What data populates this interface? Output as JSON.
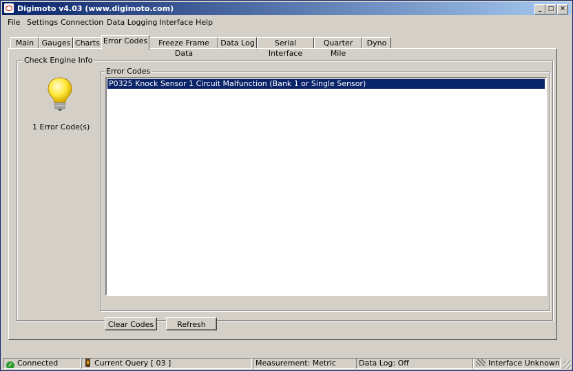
{
  "window": {
    "title": "Digimoto v4.03 (www.digimoto.com)",
    "controls": {
      "minimize": "_",
      "maximize": "□",
      "close": "✕"
    }
  },
  "menu": [
    "File",
    "Settings",
    "Connection",
    "Data Logging",
    "Interface",
    "Help"
  ],
  "tabs": [
    "Main",
    "Gauges",
    "Charts",
    "Error Codes",
    "Freeze Frame Data",
    "Data Log",
    "Serial Interface",
    "Quarter Mile",
    "Dyno"
  ],
  "active_tab": "Error Codes",
  "check_engine": {
    "group_label": "Check Engine Info",
    "icon": "light-bulb-icon",
    "count_text": "1 Error Code(s)"
  },
  "error_codes": {
    "group_label": "Error Codes",
    "items": [
      "P0325 Knock Sensor 1 Circuit Malfunction (Bank 1 or Single Sensor)"
    ],
    "selected_index": 0
  },
  "buttons": {
    "clear": "Clear Codes",
    "refresh": "Refresh"
  },
  "status": {
    "connection": "Connected",
    "query": "Current Query [ 03 ]",
    "measurement": "Measurement: Metric",
    "data_log": "Data Log: Off",
    "interface": "Interface Unknown"
  },
  "colors": {
    "selection": "#0a246a",
    "title_bar": "#0a246a",
    "face": "#d4d0c8",
    "connected_icon": "#2c9c2c"
  }
}
